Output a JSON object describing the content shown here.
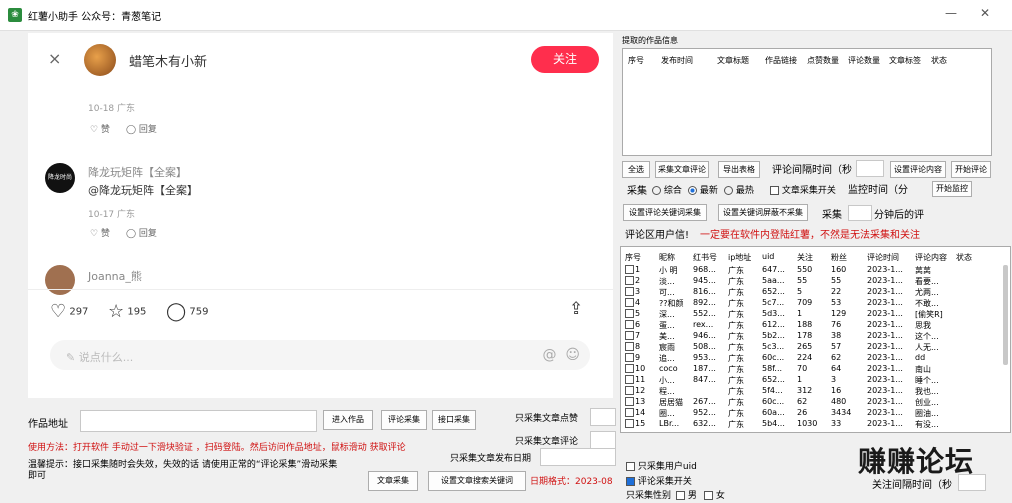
{
  "window": {
    "title": "红薯小助手  公众号：青葱笔记",
    "minimize": "—",
    "close": "✕"
  },
  "browser": {
    "close": "×",
    "author": "蜡笔木有小新",
    "follow": "关注",
    "comments": [
      {
        "date": "10-18 广东",
        "like": "♡ 赞",
        "reply": "◯ 回复"
      },
      {
        "avatar_text": "降龙时尚",
        "name": "降龙玩矩阵【全案】",
        "text": "@降龙玩矩阵【全案】",
        "date": "10-17 广东",
        "like": "♡ 赞",
        "reply": "◯ 回复"
      },
      {
        "name": "Joanna_熊"
      }
    ],
    "stats": {
      "likes": "297",
      "stars": "195",
      "comments": "759"
    },
    "comment_placeholder": "说点什么..."
  },
  "bottom": {
    "url_label": "作品地址",
    "enter_btn": "进入作品",
    "comment_btn": "评论采集",
    "api_btn": "接口采集",
    "only_likes": "只采集文章点赞",
    "only_comments": "只采集文章评论",
    "only_date": "只采集文章发布日期",
    "usage": "使用方法：打开软件  手动过一下滑块验证  ，扫码登陆。然后访问作品地址，鼠标滑动 获取评论",
    "tip": "温馨提示：接口采集随时会失效，失效的话 请使用正常的“评论采集”滑动采集即可",
    "article_btn": "文章采集",
    "keyword_btn": "设置文章搜索关键词",
    "date_format": "日期格式：2023-08"
  },
  "right": {
    "info_title": "提取的作品信息",
    "info_headers": [
      "序号",
      "发布时间",
      "文章标题",
      "作品链接",
      "点赞数量",
      "评论数量",
      "文章标签",
      "状态"
    ],
    "select_all": "全选",
    "collect_comment": "采集文章评论",
    "export": "导出表格",
    "interval_label": "评论间隔时间（秒",
    "set_comment": "设置评论内容",
    "start_comment": "开始评论",
    "collect_label": "采集",
    "radio_all": "综合",
    "radio_new": "最新",
    "radio_hot": "最热",
    "article_switch": "文章采集开关",
    "monitor_label": "监控时间（分",
    "start_monitor": "开始监控",
    "set_kw_collect": "设置评论关键词采集",
    "set_kw_block": "设置关键词屏蔽不采集",
    "collect2": "采集",
    "minutes_after": "分钟后的评",
    "user_info": "评论区用户信!",
    "warning": "一定要在软件内登陆红薯，不然是无法采集和关注",
    "user_headers": [
      "序号",
      "昵称",
      "红书号",
      "ip地址",
      "uid",
      "关注",
      "粉丝",
      "评论时间",
      "评论内容",
      "状态"
    ],
    "users": [
      [
        "1",
        "小 明",
        "968...",
        "广东",
        "647...",
        "550",
        "160",
        "2023-1...",
        "莴莴"
      ],
      [
        "2",
        "淡...",
        "945...",
        "广东",
        "5aa...",
        "55",
        "55",
        "2023-1...",
        "看要..."
      ],
      [
        "3",
        "可...",
        "816...",
        "广东",
        "652...",
        "5",
        "22",
        "2023-1...",
        "尤两..."
      ],
      [
        "4",
        "??和颜",
        "892...",
        "广东",
        "5c7...",
        "709",
        "53",
        "2023-1...",
        "不敢..."
      ],
      [
        "5",
        "深...",
        "552...",
        "广东",
        "5d3...",
        "1",
        "129",
        "2023-1...",
        "[偷笑R]"
      ],
      [
        "6",
        "蛋...",
        "rex...",
        "广东",
        "612...",
        "188",
        "76",
        "2023-1...",
        "思我"
      ],
      [
        "7",
        "美...",
        "946...",
        "广东",
        "5b2...",
        "178",
        "38",
        "2023-1...",
        "这个..."
      ],
      [
        "8",
        "宸雨",
        "508...",
        "广东",
        "5c3...",
        "265",
        "57",
        "2023-1...",
        "人无..."
      ],
      [
        "9",
        "追...",
        "953...",
        "广东",
        "60c...",
        "224",
        "62",
        "2023-1...",
        "dd"
      ],
      [
        "10",
        "coco",
        "187...",
        "广东",
        "58f...",
        "70",
        "64",
        "2023-1...",
        "南山"
      ],
      [
        "11",
        "小...",
        "847...",
        "广东",
        "652...",
        "1",
        "3",
        "2023-1...",
        "睡个..."
      ],
      [
        "12",
        "程...",
        "",
        "广东",
        "5f4...",
        "312",
        "16",
        "2023-1...",
        "我也..."
      ],
      [
        "13",
        "居居猫",
        "267...",
        "广东",
        "60c...",
        "62",
        "480",
        "2023-1...",
        "创业..."
      ],
      [
        "14",
        "圈...",
        "952...",
        "广东",
        "60a...",
        "26",
        "3434",
        "2023-1...",
        "圈油..."
      ],
      [
        "15",
        "LBr...",
        "632...",
        "广东",
        "5b4...",
        "1030",
        "33",
        "2023-1...",
        "有没..."
      ]
    ],
    "only_uid": "只采集用户uid",
    "comment_switch": "评论采集开关",
    "gender_label": "只采集性别",
    "male": "男",
    "female": "女",
    "follow_interval": "关注间隔时间（秒"
  },
  "watermark": "赚赚论坛"
}
